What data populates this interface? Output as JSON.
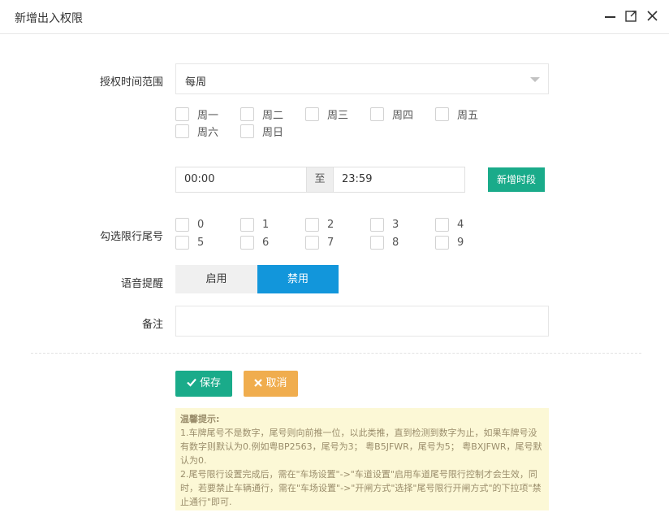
{
  "window": {
    "title": "新增出入权限",
    "controls": [
      "minimize-icon",
      "maximize-icon",
      "close-icon"
    ]
  },
  "form": {
    "time_range_label": "授权时间范围",
    "time_range_value": "每周",
    "weekdays": [
      "周一",
      "周二",
      "周三",
      "周四",
      "周五",
      "周六",
      "周日"
    ],
    "start_time": "00:00",
    "separator": "至",
    "end_time": "23:59",
    "add_period_button": "新增时段",
    "plate_tail_label": "勾选限行尾号",
    "plate_digits": [
      "0",
      "1",
      "2",
      "3",
      "4",
      "5",
      "6",
      "7",
      "8",
      "9"
    ],
    "voice_label": "语音提醒",
    "voice_enable": "启用",
    "voice_disable": "禁用",
    "voice_selected": "禁用",
    "remark_label": "备注",
    "remark_value": ""
  },
  "actions": {
    "save": "保存",
    "cancel": "取消"
  },
  "tips": {
    "title": "温馨提示:",
    "line1": "1.车牌尾号不是数字，尾号则向前推一位，以此类推，直到检测到数字为止，如果车牌号没有数字则默认为0.例如粤BP2563，尾号为3； 粤B5JFWR，尾号为5； 粤BXJFWR，尾号默认为0.",
    "line2": "2.尾号限行设置完成后，需在\"车场设置\"->\"车道设置\"启用车道尾号限行控制才会生效，同时，若要禁止车辆通行，需在\"车场设置\"->\"开闸方式\"选择\"尾号限行开闸方式\"的下拉项\"禁止通行\"即可."
  },
  "colors": {
    "primary": "#1aab8a",
    "blue": "#1296db",
    "warning": "#f0ad4e",
    "tips_bg": "#fcf8d6"
  }
}
